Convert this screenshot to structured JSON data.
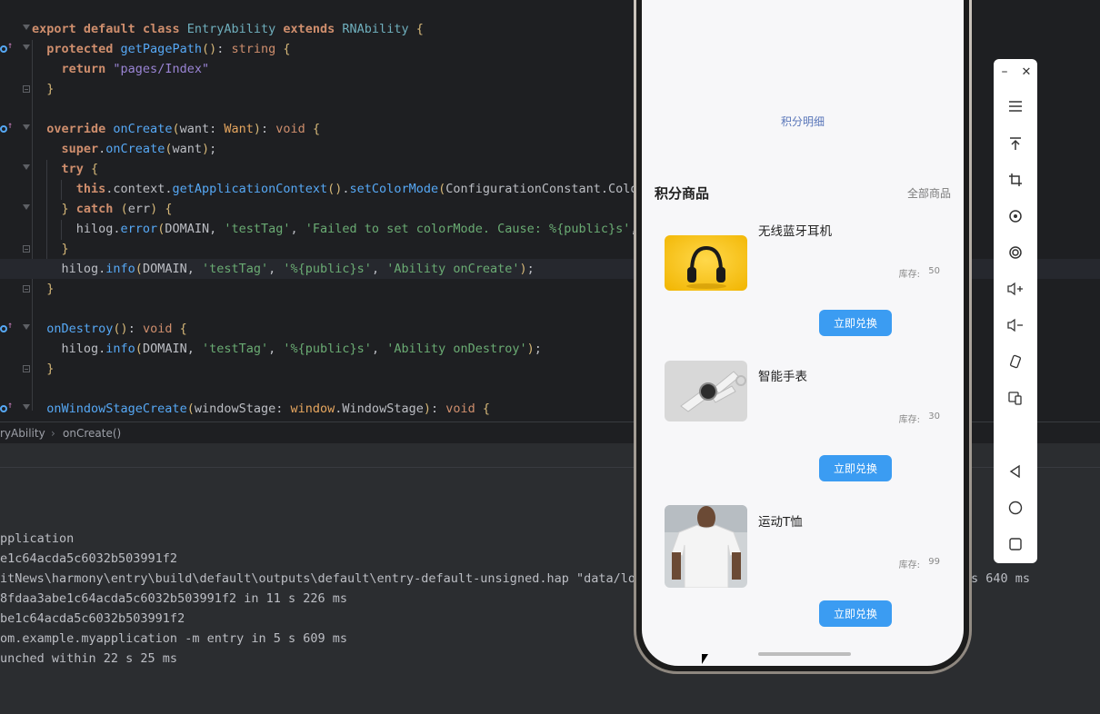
{
  "editor": {
    "lines": [
      {
        "t": [
          [
            "kwb",
            "export "
          ],
          [
            "kwb",
            "default "
          ],
          [
            "kwb",
            "class "
          ],
          [
            "ty",
            "EntryAbility "
          ],
          [
            "kwb",
            "extends "
          ],
          [
            "ty",
            "RNAbility "
          ],
          [
            "br",
            "{"
          ]
        ]
      },
      {
        "t": [
          [
            "par",
            "  "
          ],
          [
            "kwb",
            "protected "
          ],
          [
            "fn",
            "getPagePath"
          ],
          [
            "br",
            "()"
          ],
          [
            "par",
            ": "
          ],
          [
            "kw",
            "string "
          ],
          [
            "br",
            "{"
          ]
        ]
      },
      {
        "t": [
          [
            "par",
            "    "
          ],
          [
            "kwb",
            "return "
          ],
          [
            "strp",
            "\"pages/Index\""
          ]
        ]
      },
      {
        "t": [
          [
            "par",
            "  "
          ],
          [
            "br",
            "}"
          ]
        ]
      },
      {
        "t": [
          [
            "par",
            ""
          ]
        ]
      },
      {
        "t": [
          [
            "par",
            "  "
          ],
          [
            "kwb",
            "override "
          ],
          [
            "fn",
            "onCreate"
          ],
          [
            "br",
            "("
          ],
          [
            "par",
            "want: "
          ],
          [
            "warm",
            "Want"
          ],
          [
            "br",
            ")"
          ],
          [
            "par",
            ": "
          ],
          [
            "kw",
            "void "
          ],
          [
            "br",
            "{"
          ]
        ]
      },
      {
        "t": [
          [
            "par",
            "    "
          ],
          [
            "kwb",
            "super"
          ],
          [
            "par",
            "."
          ],
          [
            "fn",
            "onCreate"
          ],
          [
            "br",
            "("
          ],
          [
            "par",
            "want"
          ],
          [
            "br",
            ")"
          ],
          [
            "par",
            ";"
          ]
        ]
      },
      {
        "t": [
          [
            "par",
            "    "
          ],
          [
            "kwb",
            "try "
          ],
          [
            "br",
            "{"
          ]
        ]
      },
      {
        "t": [
          [
            "par",
            "      "
          ],
          [
            "kwb",
            "this"
          ],
          [
            "par",
            ".context."
          ],
          [
            "fn",
            "getApplicationContext"
          ],
          [
            "br",
            "()"
          ],
          [
            "par",
            "."
          ],
          [
            "fn",
            "setColorMode"
          ],
          [
            "br",
            "("
          ],
          [
            "par",
            "ConfigurationConstant.ColorMode"
          ]
        ]
      },
      {
        "t": [
          [
            "par",
            "    "
          ],
          [
            "br",
            "} "
          ],
          [
            "kwb",
            "catch "
          ],
          [
            "br",
            "("
          ],
          [
            "par",
            "err"
          ],
          [
            "br",
            ") {"
          ]
        ]
      },
      {
        "t": [
          [
            "par",
            "      hilog."
          ],
          [
            "fn",
            "error"
          ],
          [
            "br",
            "("
          ],
          [
            "par",
            "DOMAIN, "
          ],
          [
            "str",
            "'testTag'"
          ],
          [
            "par",
            ", "
          ],
          [
            "str",
            "'Failed to set colorMode. Cause: %{public}s'"
          ],
          [
            "par",
            ", JSON."
          ]
        ]
      },
      {
        "t": [
          [
            "par",
            "    "
          ],
          [
            "br",
            "}"
          ]
        ]
      },
      {
        "t": [
          [
            "par",
            "    hilog."
          ],
          [
            "fn",
            "info"
          ],
          [
            "br",
            "("
          ],
          [
            "par",
            "DOMAIN, "
          ],
          [
            "str",
            "'testTag'"
          ],
          [
            "par",
            ", "
          ],
          [
            "str",
            "'%{public}s'"
          ],
          [
            "par",
            ", "
          ],
          [
            "str",
            "'Ability onCreate'"
          ],
          [
            "br",
            ")"
          ],
          [
            "par",
            ";"
          ]
        ]
      },
      {
        "t": [
          [
            "par",
            "  "
          ],
          [
            "br",
            "}"
          ]
        ]
      },
      {
        "t": [
          [
            "par",
            ""
          ]
        ]
      },
      {
        "t": [
          [
            "par",
            "  "
          ],
          [
            "fn",
            "onDestroy"
          ],
          [
            "br",
            "()"
          ],
          [
            "par",
            ": "
          ],
          [
            "kw",
            "void "
          ],
          [
            "br",
            "{"
          ]
        ]
      },
      {
        "t": [
          [
            "par",
            "    hilog."
          ],
          [
            "fn",
            "info"
          ],
          [
            "br",
            "("
          ],
          [
            "par",
            "DOMAIN, "
          ],
          [
            "str",
            "'testTag'"
          ],
          [
            "par",
            ", "
          ],
          [
            "str",
            "'%{public}s'"
          ],
          [
            "par",
            ", "
          ],
          [
            "str",
            "'Ability onDestroy'"
          ],
          [
            "br",
            ")"
          ],
          [
            "par",
            ";"
          ]
        ]
      },
      {
        "t": [
          [
            "par",
            "  "
          ],
          [
            "br",
            "}"
          ]
        ]
      },
      {
        "t": [
          [
            "par",
            ""
          ]
        ]
      },
      {
        "t": [
          [
            "par",
            "  "
          ],
          [
            "fn",
            "onWindowStageCreate"
          ],
          [
            "br",
            "("
          ],
          [
            "par",
            "windowStage: "
          ],
          [
            "warm",
            "window"
          ],
          [
            "par",
            ".WindowStage"
          ],
          [
            "br",
            ")"
          ],
          [
            "par",
            ": "
          ],
          [
            "kw",
            "void "
          ],
          [
            "br",
            "{"
          ]
        ]
      }
    ]
  },
  "breadcrumb": {
    "class_name": "ryAbility",
    "method": "onCreate()"
  },
  "console": {
    "lines": [
      "pplication",
      "e1c64acda5c6032b503991f2",
      "itNews\\harmony\\entry\\build\\default\\outputs\\default\\entry-default-unsigned.hap \"data/loc",
      "8fdaa3abe1c64acda5c6032b503991f2 in 11 s 226 ms",
      "be1c64acda5c6032b503991f2",
      "om.example.myapplication -m entry in 5 s 609 ms",
      "unched within 22 s 25 ms"
    ],
    "right_fragment": "s 640 ms"
  },
  "phone": {
    "points_detail": "积分明细",
    "section_title": "积分商品",
    "section_all": "全部商品",
    "stock_label": "库存:",
    "redeem_label": "立即兑换",
    "products": [
      {
        "name": "无线蓝牙耳机",
        "stock": "50"
      },
      {
        "name": "智能手表",
        "stock": "30"
      },
      {
        "name": "运动T恤",
        "stock": "99"
      }
    ]
  },
  "toolbar": {
    "minimize": "–",
    "close": "✕"
  }
}
